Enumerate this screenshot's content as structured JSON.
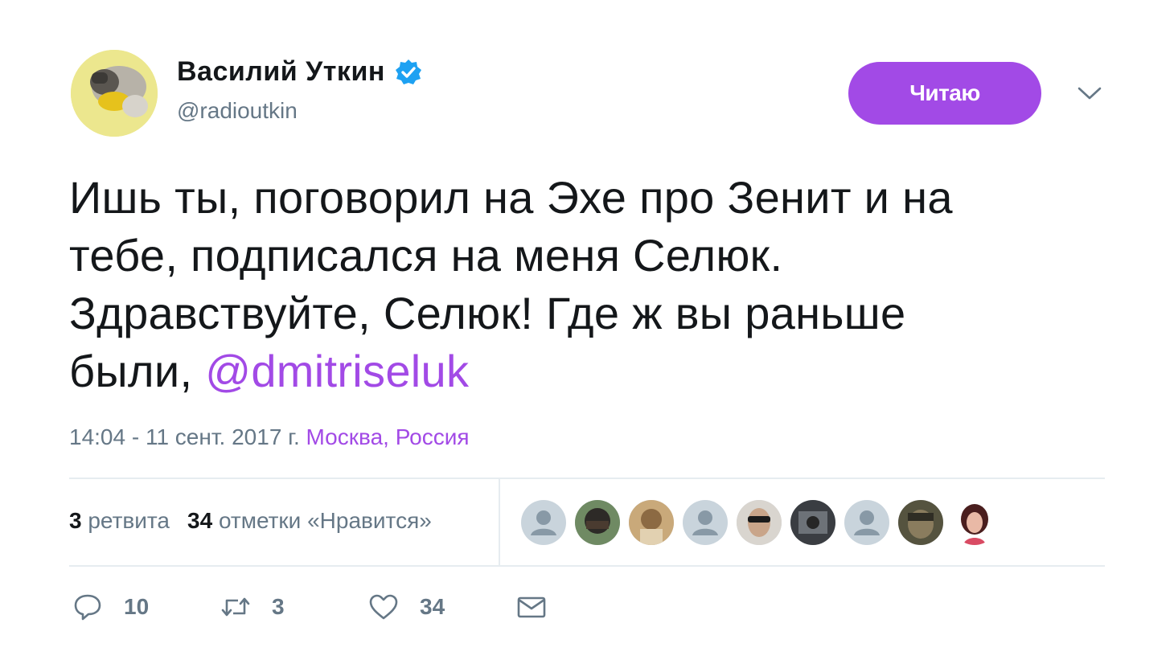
{
  "author": {
    "name": "Василий Уткин",
    "handle": "@radioutkin",
    "verified": true
  },
  "follow_button": {
    "label": "Читаю"
  },
  "tweet": {
    "text_lines": [
      "Ишь ты, поговорил на Эхе про Зенит и на",
      "тебе, подписался на меня Селюк.",
      "Здравствуйте, Селюк! Где ж вы раньше"
    ],
    "last_line_prefix": "были, ",
    "mention": "@dmitriseluk"
  },
  "meta": {
    "timestamp": "14:04 - 11 сент. 2017 г.",
    "location": "Москва, Россия"
  },
  "stats": {
    "retweets_count": "3",
    "retweets_label": "ретвита",
    "likes_count": "34",
    "likes_label": "отметки «Нравится»"
  },
  "likers": [
    {
      "icon": "default-avatar-icon"
    },
    {
      "icon": "user-photo-avatar"
    },
    {
      "icon": "user-photo-avatar"
    },
    {
      "icon": "default-avatar-icon"
    },
    {
      "icon": "user-photo-avatar"
    },
    {
      "icon": "user-photo-avatar"
    },
    {
      "icon": "default-avatar-icon"
    },
    {
      "icon": "user-photo-avatar"
    },
    {
      "icon": "user-photo-avatar"
    }
  ],
  "actions": {
    "reply": {
      "icon": "reply-icon",
      "count": "10"
    },
    "retweet": {
      "icon": "retweet-icon",
      "count": "3"
    },
    "like": {
      "icon": "heart-icon",
      "count": "34"
    },
    "dm": {
      "icon": "envelope-icon"
    }
  },
  "colors": {
    "accent": "#a24ae6",
    "verified": "#1da1f2",
    "muted": "#657786",
    "text": "#14171a"
  }
}
